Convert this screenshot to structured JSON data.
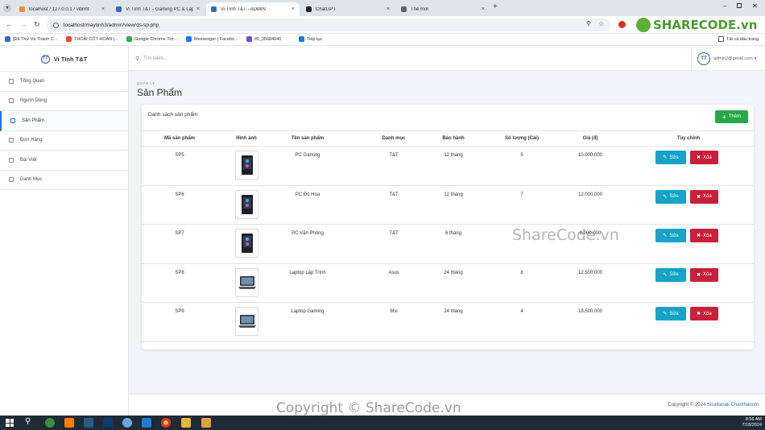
{
  "browser": {
    "tabs": [
      {
        "label": "localhost / 127.0.0.1 / vitinht",
        "color": "#e8912d"
      },
      {
        "label": "Vi Tính T&T - Gaming PC & Lap",
        "color": "#2f6db5"
      },
      {
        "label": "Vi Tính T&T - ADMIN",
        "color": "#2f6db5"
      },
      {
        "label": "ChatGPT",
        "color": "#222222"
      },
      {
        "label": "Thẻ mới",
        "color": "#5f6368"
      }
    ],
    "url": "localhost/maytinh3/admin/view/ds-sp.php",
    "bookmarks": [
      {
        "label": "[Đã Thử Và Thành C...",
        "color": "#3367d6"
      },
      {
        "label": "THOẢI CỐT HOÀN |...",
        "color": "#e5492d"
      },
      {
        "label": "Google Chrome Trợ...",
        "color": "#34a853"
      },
      {
        "label": "Messenger | Facebo...",
        "color": "#1877f2"
      },
      {
        "label": "if0_35684640",
        "color": "#6b4bd6"
      },
      {
        "label": "Tiếp tục",
        "color": "#1877f2"
      }
    ],
    "all_bookmarks": "Tất cả dấu trang",
    "watermark_logo": "SHARECODE.vn"
  },
  "sidebar": {
    "brand": "Vi Tính T&T",
    "logo_letters": "TT",
    "items": [
      {
        "label": "Tổng Quan"
      },
      {
        "label": "Người Dùng"
      },
      {
        "label": "Sản Phẩm"
      },
      {
        "label": "Đơn Hàng"
      },
      {
        "label": "Bài Viết"
      },
      {
        "label": "Danh Mục"
      }
    ]
  },
  "topbar": {
    "search_placeholder": "Tìm kiếm...",
    "user_email": "admin2@gmail.com",
    "user_caret": "▾",
    "avatar_letters": "TT"
  },
  "page": {
    "breadcrumb": "QUẢN LÝ",
    "title": "Sản Phẩm",
    "card_title": "Danh sách sản phẩm",
    "add_button": "Thêm"
  },
  "table": {
    "headers": [
      "Mã sản phẩm",
      "Hình ảnh",
      "Tên sản phẩm",
      "Danh mục",
      "Bảo hành",
      "Số lượng (Cái)",
      "Giá (đ)",
      "Tùy chỉnh"
    ],
    "rows": [
      {
        "code": "SP5",
        "name": "PC Gaming",
        "category": "T&T",
        "warranty": "12 tháng",
        "qty": "5",
        "price": "10.000.000",
        "thumb": "pc"
      },
      {
        "code": "SP6",
        "name": "PC Đồ Họa",
        "category": "T&T",
        "warranty": "12 tháng",
        "qty": "7",
        "price": "12.000.000",
        "thumb": "pc"
      },
      {
        "code": "SP7",
        "name": "PC Văn Phòng",
        "category": "T&T",
        "warranty": "6 tháng",
        "qty": "",
        "price": "6.000.000",
        "thumb": "pc"
      },
      {
        "code": "SP8",
        "name": "Laptop Lập Trình",
        "category": "Asus",
        "warranty": "24 tháng",
        "qty": "8",
        "price": "12.500.000",
        "thumb": "laptop"
      },
      {
        "code": "SP9",
        "name": "Laptop Gaming",
        "category": "Msi",
        "warranty": "24 tháng",
        "qty": "4",
        "price": "18.500.000",
        "thumb": "laptop"
      }
    ],
    "edit_label": "Sửa",
    "delete_label": "Xóa"
  },
  "footer": {
    "prefix": "Copyright © 2024",
    "author": "Sisattanak Chanthanom"
  },
  "watermarks": {
    "center": "ShareCode.vn",
    "bottom": "Copyright © ShareCode.vn"
  },
  "taskbar": {
    "time": "8:56 AM",
    "date": "7/18/2024"
  },
  "colors": {
    "accent_blue": "#1a73e8",
    "add_green": "#28a745",
    "edit_cyan": "#17a2c8",
    "delete_red": "#c8203a"
  }
}
